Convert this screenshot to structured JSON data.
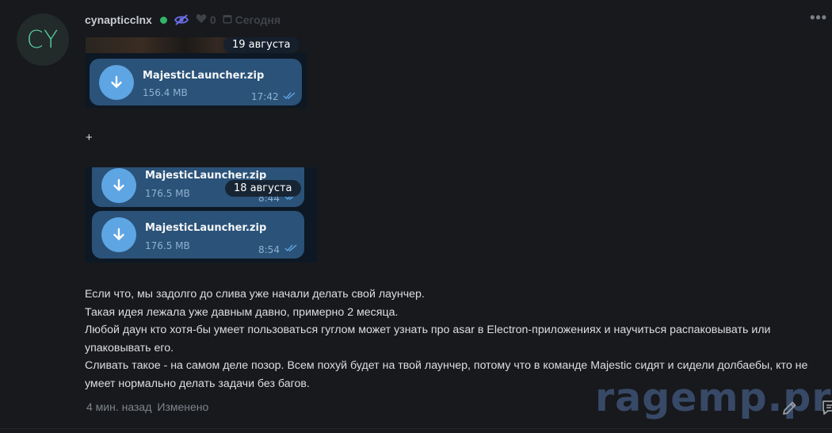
{
  "avatar": {
    "initials": "CY",
    "color": "#55c99a"
  },
  "header": {
    "username": "cynapticclnx",
    "status": "online",
    "likes_count": "0",
    "date_label": "Сегодня"
  },
  "telegram_top": {
    "date_pill": "19 августа",
    "file": {
      "name": "MajesticLauncher.zip",
      "size": "156.4 MB",
      "time": "17:42"
    }
  },
  "separator": "+",
  "telegram_bottom": {
    "date_pill": "18 августа",
    "files": [
      {
        "name": "MajesticLauncher.zip",
        "size": "176.5 MB",
        "time": "8:44"
      },
      {
        "name": "MajesticLauncher.zip",
        "size": "176.5 MB",
        "time": "8:54"
      }
    ]
  },
  "body": {
    "lines": [
      "Если что, мы задолго до слива уже начали делать свой лаунчер.",
      "Такая идея лежала уже давным давно, примерно 2 месяца.",
      "Любой даун кто хотя-бы умеет пользоваться гуглом может узнать про asar в Electron-приложениях и научиться распаковывать или упаковывать его.",
      "Сливать такое - на самом деле позор. Всем похуй будет на твой лаунчер, потому что в команде Majestic сидят и сидели долбаебы, кто не умеет нормально делать задачи без багов."
    ]
  },
  "footer": {
    "time_ago": "4 мин. назад",
    "edited": "Изменено"
  },
  "watermark": "ragemp.pro",
  "colors": {
    "background": "#17191d",
    "accent_green": "#55c99a",
    "tg_bubble": "#2b5278",
    "tg_download": "#5ea5e4"
  }
}
